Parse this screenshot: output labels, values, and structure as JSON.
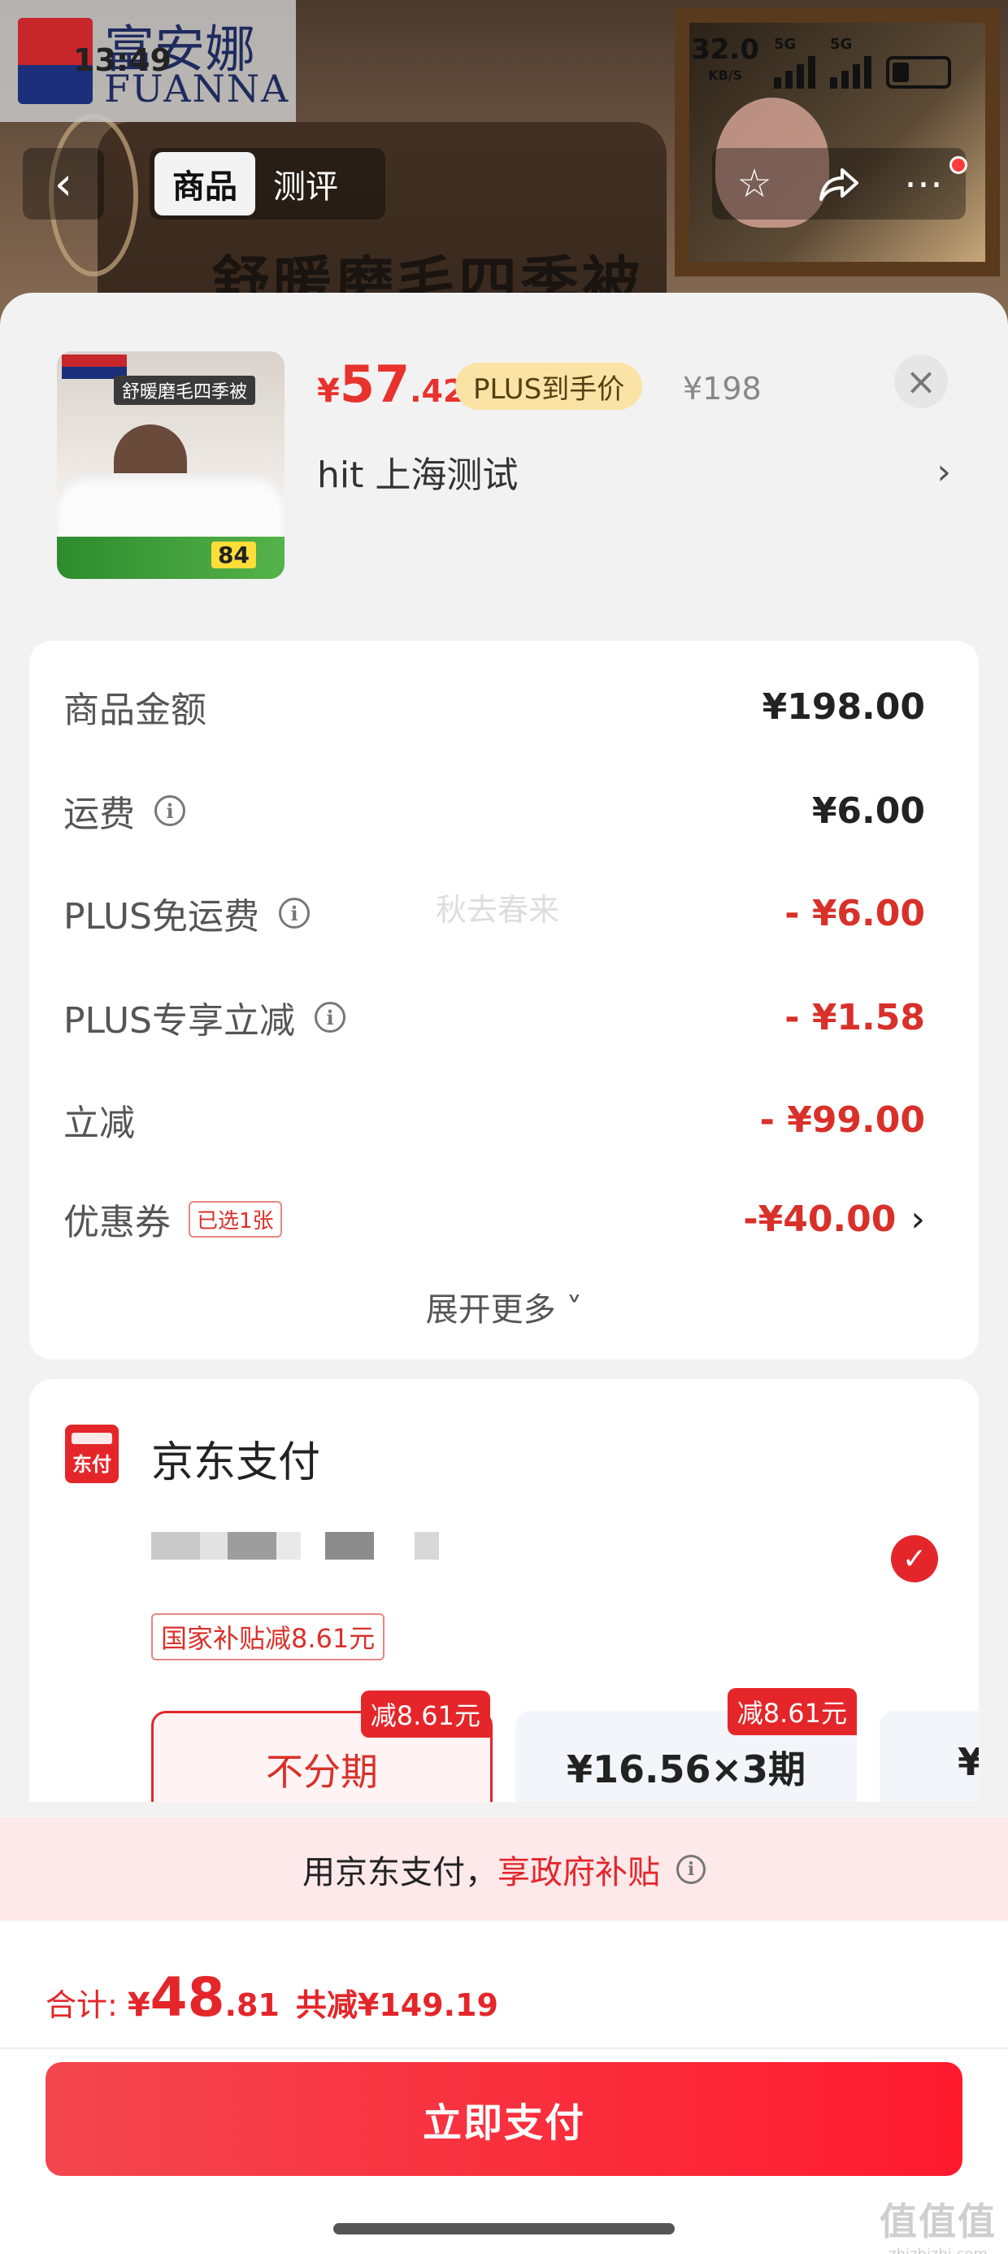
{
  "status_bar": {
    "time": "13:49",
    "net_speed": "32.0",
    "net_unit": "KB/S",
    "sig1": "5G",
    "sig2": "5G"
  },
  "background": {
    "brand_cn": "富安娜",
    "brand_en": "FUANNA",
    "title_overlay": "舒暖磨毛四季被"
  },
  "nav": {
    "tab_product": "商品",
    "tab_review": "测评"
  },
  "product": {
    "image_title": "舒暖磨毛四季被",
    "image_promo_number": "84",
    "price_currency": "¥",
    "price_int": "57",
    "price_dec": ".42",
    "plus_badge": "PLUS到手价",
    "original_price": "¥198",
    "spec": "hit  上海测试",
    "spec_arrow": "›"
  },
  "price_detail": {
    "rows": [
      {
        "label": "商品金额",
        "value": "¥198.00"
      },
      {
        "label": "运费",
        "value": "¥6.00"
      },
      {
        "label": "PLUS免运费",
        "value": "- ¥6.00"
      },
      {
        "label": "PLUS专享立减",
        "value": "- ¥1.58"
      },
      {
        "label": "立减",
        "value": "- ¥99.00"
      },
      {
        "label": "优惠券",
        "value": "-¥40.00",
        "tag": "已选1张"
      }
    ],
    "expand": "展开更多 ˅",
    "watermark": "秋去春来"
  },
  "payment": {
    "icon_text": "东付",
    "title": "京东支付",
    "subsidy_tag": "国家补贴减8.61元",
    "plans": [
      {
        "label": "不分期",
        "badge": "减8.61元"
      },
      {
        "label": "¥16.56×3期",
        "badge": "减8.61元"
      },
      {
        "label": "¥"
      }
    ]
  },
  "subsidy_strip": {
    "text": "用京东支付，",
    "highlight": "享政府补贴"
  },
  "footer": {
    "total_label": "合计:",
    "total_currency": "¥",
    "total_int": "48",
    "total_dec": ".81",
    "total_saved": "共减¥149.19",
    "pay_button": "立即支付",
    "site_wm": "值值值",
    "site_wm_url": "zhizhizhi.com"
  },
  "colors": {
    "accent_red": "#e4262a",
    "price_red": "#d9302a",
    "plus_badge_bg": "#fbe3a5",
    "strip_bg": "#fde8ea"
  }
}
